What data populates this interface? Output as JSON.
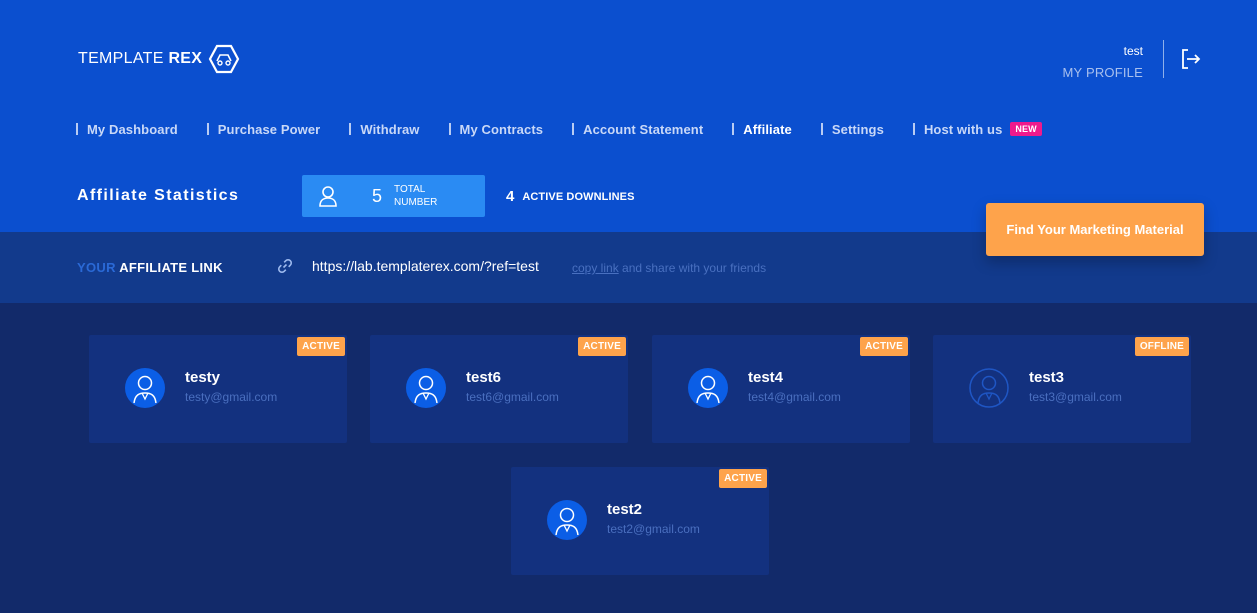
{
  "header": {
    "logo_text_light": "TEMPLATE",
    "logo_text_bold": "REX",
    "username": "test",
    "profile_link": "MY PROFILE"
  },
  "nav": {
    "items": [
      {
        "label": "My Dashboard"
      },
      {
        "label": "Purchase Power"
      },
      {
        "label": "Withdraw"
      },
      {
        "label": "My Contracts"
      },
      {
        "label": "Account Statement"
      },
      {
        "label": "Affiliate"
      },
      {
        "label": "Settings"
      },
      {
        "label": "Host with us"
      }
    ],
    "active": "Affiliate",
    "new_badge": "NEW"
  },
  "stats": {
    "title": "Affiliate Statistics",
    "total_value": "5",
    "total_label_1": "TOTAL",
    "total_label_2": "NUMBER",
    "active_value": "4",
    "active_label": "ACTIVE DOWNLINES"
  },
  "marketing_button": "Find Your Marketing Material",
  "affiliate_link": {
    "label_prefix": "YOUR",
    "label": "AFFILIATE LINK",
    "url": "https://lab.templaterex.com/?ref=test",
    "copy_link": "copy link",
    "copy_suffix": "and share with your friends"
  },
  "downlines": [
    {
      "name": "testy",
      "email": "testy@gmail.com",
      "status": "ACTIVE"
    },
    {
      "name": "test6",
      "email": "test6@gmail.com",
      "status": "ACTIVE"
    },
    {
      "name": "test4",
      "email": "test4@gmail.com",
      "status": "ACTIVE"
    },
    {
      "name": "test3",
      "email": "test3@gmail.com",
      "status": "OFFLINE"
    },
    {
      "name": "test2",
      "email": "test2@gmail.com",
      "status": "ACTIVE"
    }
  ],
  "colors": {
    "header_bg": "#0b4fcf",
    "page_bg": "#122a6a",
    "accent_orange": "#fea34b",
    "new_badge": "#ef1a8c"
  }
}
